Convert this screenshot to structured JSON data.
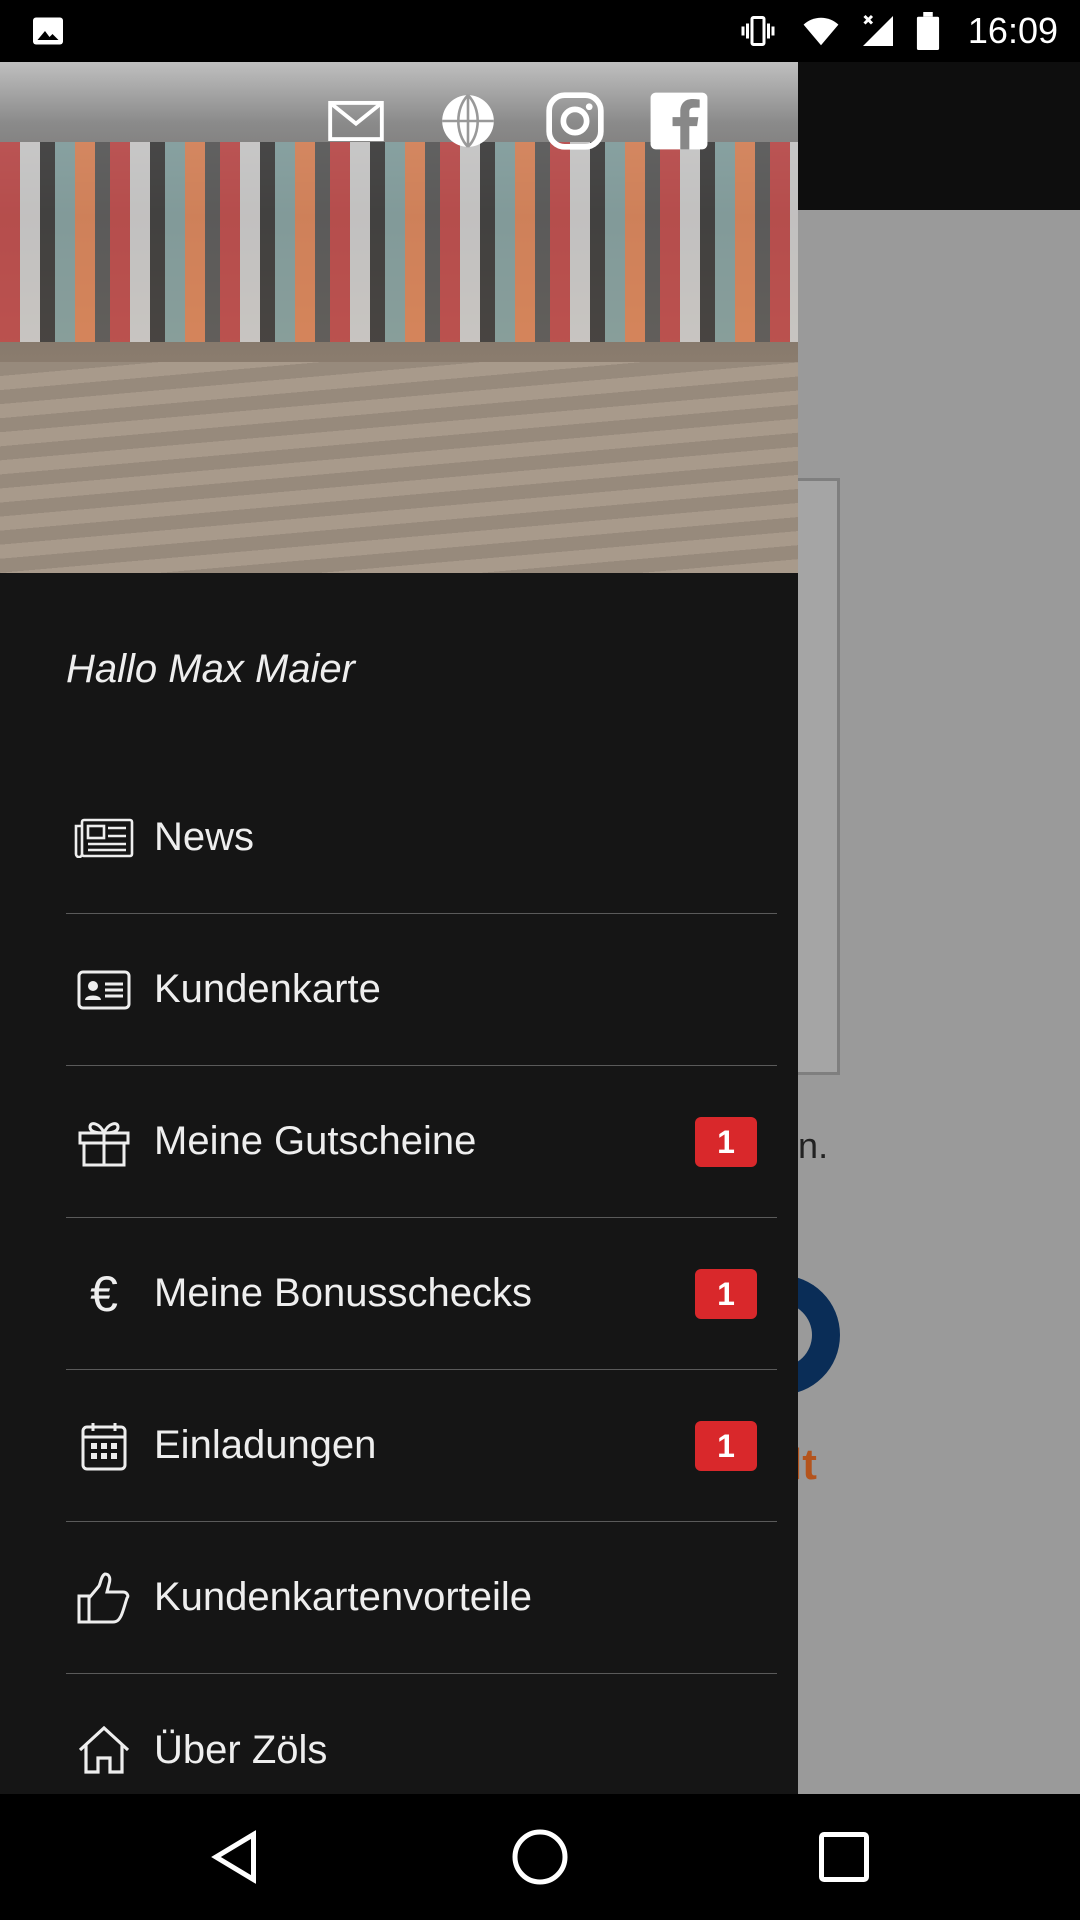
{
  "status_bar": {
    "time": "16:09",
    "icons": [
      "image-icon",
      "vibrate-icon",
      "wifi-icon",
      "signal-no-data-icon",
      "battery-icon"
    ]
  },
  "background": {
    "partial_text": "rzeigen.",
    "logo_partial": "lt",
    "colors": {
      "logo_blue": "#0a2d57",
      "logo_orange": "#b4541d"
    }
  },
  "drawer": {
    "social_icons": [
      "mail-icon",
      "globe-icon",
      "instagram-icon",
      "facebook-icon"
    ],
    "greeting": "Hallo Max Maier",
    "items": [
      {
        "label": "News",
        "icon": "newspaper-icon",
        "badge": null
      },
      {
        "label": "Kundenkarte",
        "icon": "id-card-icon",
        "badge": null
      },
      {
        "label": "Meine Gutscheine",
        "icon": "gift-icon",
        "badge": "1"
      },
      {
        "label": "Meine Bonusschecks",
        "icon": "euro-icon",
        "badge": "1"
      },
      {
        "label": "Einladungen",
        "icon": "calendar-icon",
        "badge": "1"
      },
      {
        "label": "Kundenkartenvorteile",
        "icon": "thumbs-up-icon",
        "badge": null
      },
      {
        "label": "Über Zöls",
        "icon": "home-icon",
        "badge": null
      }
    ],
    "badge_color": "#d9282b"
  },
  "nav_bar": {
    "buttons": [
      "back-icon",
      "home-icon",
      "recents-icon"
    ]
  }
}
